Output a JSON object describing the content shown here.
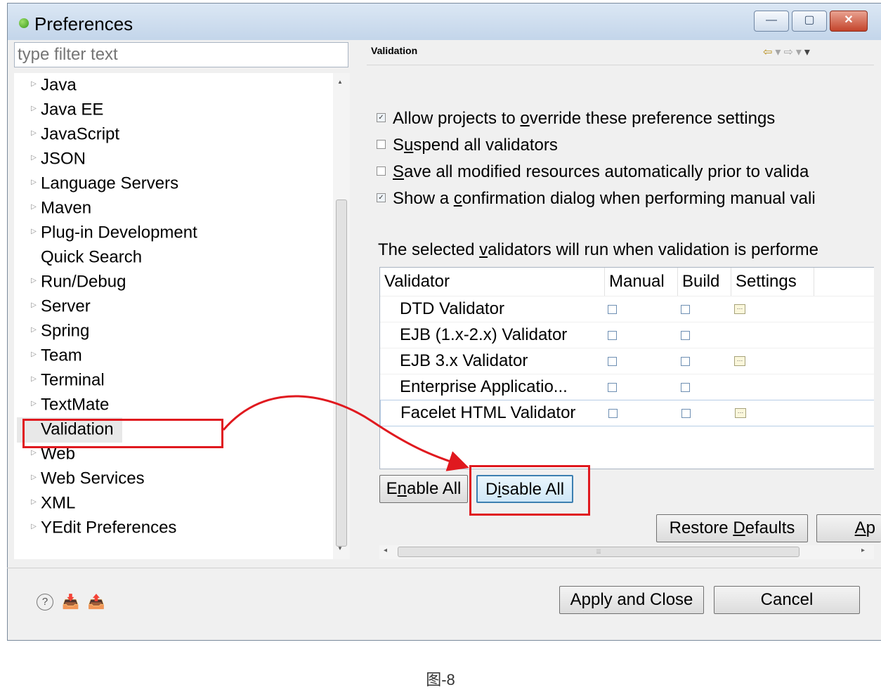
{
  "window": {
    "title": "Preferences",
    "minimize_label": "—",
    "maximize_label": "▢",
    "close_label": "✕"
  },
  "sidebar": {
    "filter_placeholder": "type filter text",
    "items": [
      {
        "label": "Java",
        "expandable": true
      },
      {
        "label": "Java EE",
        "expandable": true
      },
      {
        "label": "JavaScript",
        "expandable": true
      },
      {
        "label": "JSON",
        "expandable": true
      },
      {
        "label": "Language Servers",
        "expandable": true
      },
      {
        "label": "Maven",
        "expandable": true
      },
      {
        "label": "Plug-in Development",
        "expandable": true
      },
      {
        "label": "Quick Search",
        "expandable": false
      },
      {
        "label": "Run/Debug",
        "expandable": true
      },
      {
        "label": "Server",
        "expandable": true
      },
      {
        "label": "Spring",
        "expandable": true
      },
      {
        "label": "Team",
        "expandable": true
      },
      {
        "label": "Terminal",
        "expandable": true
      },
      {
        "label": "TextMate",
        "expandable": true
      },
      {
        "label": "Validation",
        "expandable": false,
        "selected": true
      },
      {
        "label": "Web",
        "expandable": true
      },
      {
        "label": "Web Services",
        "expandable": true
      },
      {
        "label": "XML",
        "expandable": true
      },
      {
        "label": "YEdit Preferences",
        "expandable": true
      }
    ]
  },
  "page": {
    "title": "Validation",
    "options": [
      {
        "checked": true,
        "pre": "Allow projects to ",
        "mnemonic": "o",
        "post": "verride these preference settings"
      },
      {
        "checked": false,
        "pre": "S",
        "mnemonic": "u",
        "post": "spend all validators"
      },
      {
        "checked": false,
        "pre": "",
        "mnemonic": "S",
        "post": "ave all modified resources automatically prior to valida"
      },
      {
        "checked": true,
        "pre": "Show a ",
        "mnemonic": "c",
        "post": "onfirmation dialog when performing manual vali"
      }
    ],
    "info_pre": "The selected ",
    "info_mnemonic": "v",
    "info_post": "alidators will run when validation is performe",
    "table": {
      "headers": [
        "Validator",
        "Manual",
        "Build",
        "Settings"
      ],
      "rows": [
        {
          "name": "DTD Validator",
          "manual": false,
          "build": false,
          "settings": true
        },
        {
          "name": "EJB (1.x-2.x) Validator",
          "manual": false,
          "build": false,
          "settings": false
        },
        {
          "name": "EJB 3.x Validator",
          "manual": false,
          "build": false,
          "settings": true
        },
        {
          "name": "Enterprise Applicatio...",
          "manual": false,
          "build": false,
          "settings": false
        },
        {
          "name": "Facelet HTML Validator",
          "manual": false,
          "build": false,
          "settings": true
        }
      ]
    },
    "enable_all": {
      "pre": "E",
      "mnemonic": "n",
      "post": "able All"
    },
    "disable_all": {
      "pre": "D",
      "mnemonic": "i",
      "post": "sable All"
    },
    "restore_defaults": {
      "pre": "Restore ",
      "mnemonic": "D",
      "post": "efaults"
    },
    "apply_partial": {
      "pre": "",
      "mnemonic": "A",
      "post": "p"
    }
  },
  "footer": {
    "apply_close": "Apply and Close",
    "cancel": "Cancel",
    "help_symbol": "?"
  },
  "annotation": {
    "color": "#e0191f"
  },
  "caption": "图-8"
}
